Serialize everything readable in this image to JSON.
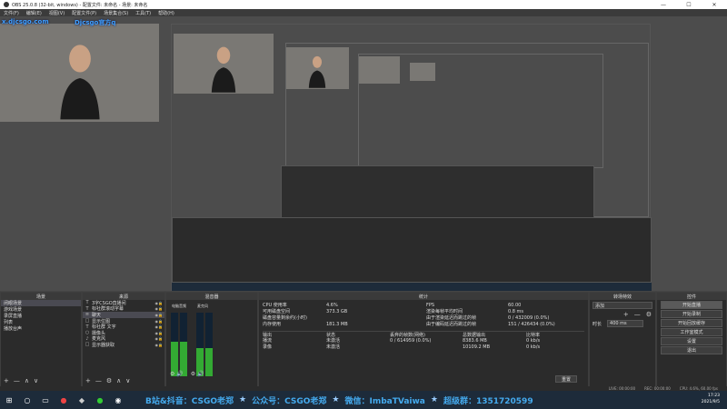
{
  "window": {
    "title": "OBS 25.0.8 (32-bit, windows) - 配置文件: 未命名 - 场景: 未命名"
  },
  "menu": [
    "文件(F)",
    "编辑(E)",
    "视图(V)",
    "配置文件(P)",
    "场景集合(S)",
    "工具(T)",
    "帮助(H)"
  ],
  "preview": {
    "brand_left": "x.djcsgo.com",
    "brand_right": "Djcsgo官方q"
  },
  "scenes": {
    "title": "场景",
    "items": [
      "闭眼场景",
      "游戏场景",
      "录屏直播",
      "列表",
      "播放台声"
    ]
  },
  "sources": {
    "title": "来源",
    "items": [
      {
        "icon": "T",
        "label": "3字CSGO直播间"
      },
      {
        "icon": "T",
        "label": "标社群滚动字幕"
      },
      {
        "icon": "≡",
        "label": "聊天"
      },
      {
        "icon": "□",
        "label": "显示位图"
      },
      {
        "icon": "T",
        "label": "标社群 文字"
      },
      {
        "icon": "○",
        "label": "摄像头"
      },
      {
        "icon": "♪",
        "label": "麦克风"
      },
      {
        "icon": "□",
        "label": "显示器获取"
      }
    ]
  },
  "mixer": {
    "title": "混音器",
    "channels": [
      {
        "label": "电脑音频",
        "level": 0.55
      },
      {
        "label": "麦克风",
        "level": 0.45
      }
    ]
  },
  "stats": {
    "title": "统计",
    "rows": [
      [
        "CPU 使用率",
        "4.6%",
        "FPS",
        "60.00"
      ],
      [
        "可用磁盘空间",
        "373.3 GB",
        "渲染每帧平均时间",
        "0.8 ms"
      ],
      [
        "磁盘容量剩余约(小时)",
        "",
        "由于渲染延迟而跳过的帧",
        "0 / 432009 (0.0%)"
      ],
      [
        "内存使用",
        "181.3 MB",
        "由于编码延迟而跳过的帧",
        "151 / 426434 (0.0%)"
      ]
    ],
    "output_header": [
      "输出",
      "状态",
      "丢弃的帧数(网络)",
      "总数据输出",
      "比特率"
    ],
    "outputs": [
      [
        "播流",
        "未激活",
        "0 / 614959 (0.0%)",
        "8383.6 MB",
        "0 kb/s"
      ],
      [
        "录像",
        "未激活",
        "",
        "10109.2 MB",
        "0 kb/s"
      ]
    ],
    "reset": "重置"
  },
  "transitions": {
    "title": "转场特效",
    "type": "淡入淡出",
    "add": "添加",
    "duration_label": "时长",
    "duration": "400 ms"
  },
  "controls": {
    "title": "控件",
    "buttons": [
      "开始直播",
      "开始录制",
      "开始回放缓存",
      "工作室模式",
      "设置",
      "退出"
    ]
  },
  "statusbar": {
    "live": "LIVE: 00:00:00",
    "rec": "REC: 00:00:00",
    "cpu": "CPU: 4.6%, 60.00 fps"
  },
  "taskbar": {
    "ticker": [
      "B站&抖音：CSGO老郑",
      "公众号：CSGO老郑",
      "微信：ImbaTVaiwa",
      "超级群：1351720599"
    ],
    "time": "17:23",
    "date": "2021/9/5"
  },
  "colors": {
    "accent": "#3fa0ff",
    "panel": "#2b2b2b",
    "taskbar": "#1d2b3a"
  }
}
